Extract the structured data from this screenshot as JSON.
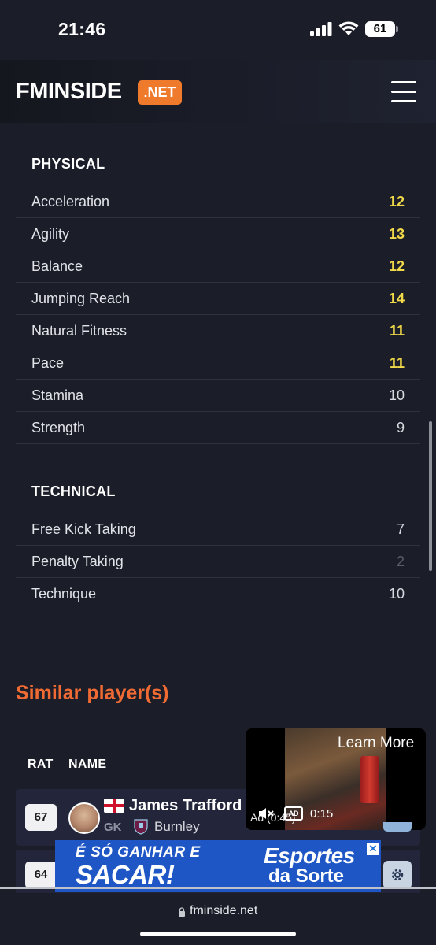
{
  "status_bar": {
    "time": "21:46",
    "battery": "61"
  },
  "header": {
    "logo_text": "FMINSIDE",
    "logo_badge": ".NET"
  },
  "physical": {
    "title": "PHYSICAL",
    "attributes": [
      {
        "name": "Acceleration",
        "value": "12"
      },
      {
        "name": "Agility",
        "value": "13"
      },
      {
        "name": "Balance",
        "value": "12"
      },
      {
        "name": "Jumping Reach",
        "value": "14"
      },
      {
        "name": "Natural Fitness",
        "value": "11"
      },
      {
        "name": "Pace",
        "value": "11"
      },
      {
        "name": "Stamina",
        "value": "10"
      },
      {
        "name": "Strength",
        "value": "9"
      }
    ]
  },
  "technical": {
    "title": "TECHNICAL",
    "attributes": [
      {
        "name": "Free Kick Taking",
        "value": "7"
      },
      {
        "name": "Penalty Taking",
        "value": "2"
      },
      {
        "name": "Technique",
        "value": "10"
      }
    ]
  },
  "similar": {
    "title": "Similar player(s)",
    "columns": {
      "rating": "RAT",
      "name": "NAME"
    },
    "players": [
      {
        "rating": "67",
        "name": "James Trafford",
        "position": "GK",
        "club": "Burnley"
      },
      {
        "rating": "64"
      }
    ]
  },
  "video_ad": {
    "learn_more": "Learn More",
    "ad_label": "Ad (0:45)",
    "cc": "AD",
    "time": "0:15"
  },
  "banner_ad": {
    "line1": "É SÓ GANHAR E",
    "line2": "SACAR!",
    "brand1": "Esportes",
    "brand2": "da Sorte",
    "close": "✕"
  },
  "browser": {
    "url": "fminside.net"
  },
  "colors": {
    "accent_orange": "#f07a2c",
    "highlight_yellow": "#f2d94a",
    "background": "#1b1d28"
  }
}
